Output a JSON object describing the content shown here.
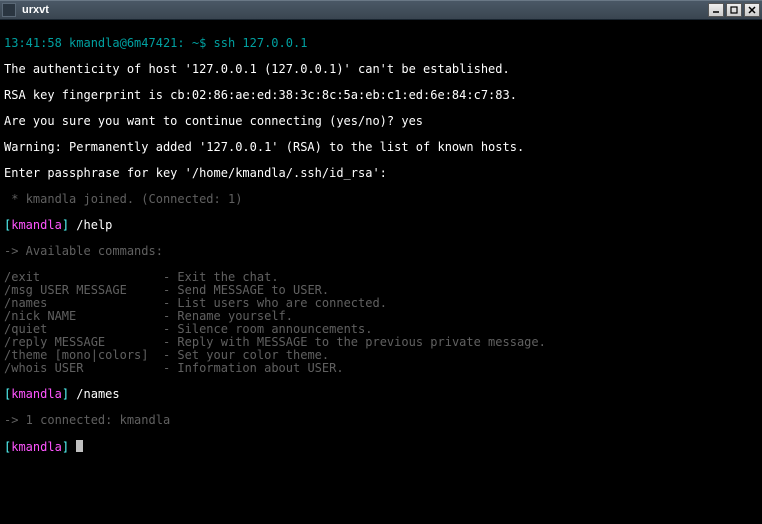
{
  "window": {
    "title": "urxvt",
    "buttons": {
      "minimize": "_",
      "maximize": "□",
      "close": "×"
    }
  },
  "ssh": {
    "prompt": "13:41:58 kmandla@6m47421: ~$ ssh 127.0.0.1",
    "auth_line": "The authenticity of host '127.0.0.1 (127.0.0.1)' can't be established.",
    "fingerprint": "RSA key fingerprint is cb:02:86:ae:ed:38:3c:8c:5a:eb:c1:ed:6e:84:c7:83.",
    "confirm": "Are you sure you want to continue connecting (yes/no)? yes",
    "warning": "Warning: Permanently added '127.0.0.1' (RSA) to the list of known hosts.",
    "passphrase": "Enter passphrase for key '/home/kmandla/.ssh/id_rsa':"
  },
  "chat": {
    "joined_star": " * ",
    "joined_rest": "kmandla joined. (Connected: 1)",
    "help_header": "-> Available commands:",
    "help_cmds": [
      {
        "cmd": "/exit",
        "desc": "- Exit the chat."
      },
      {
        "cmd": "/msg USER MESSAGE",
        "desc": "- Send MESSAGE to USER."
      },
      {
        "cmd": "/names",
        "desc": "- List users who are connected."
      },
      {
        "cmd": "/nick NAME",
        "desc": "- Rename yourself."
      },
      {
        "cmd": "/quiet",
        "desc": "- Silence room announcements."
      },
      {
        "cmd": "/reply MESSAGE",
        "desc": "- Reply with MESSAGE to the previous private message."
      },
      {
        "cmd": "/theme [mono|colors]",
        "desc": "- Set your color theme."
      },
      {
        "cmd": "/whois USER",
        "desc": "- Information about USER."
      }
    ],
    "names_response": "-> 1 connected: kmandla",
    "bracket_open": "[",
    "bracket_close": "]",
    "user": "kmandla",
    "cmd_help": " /help",
    "cmd_names": " /names",
    "cmd_input": " "
  }
}
